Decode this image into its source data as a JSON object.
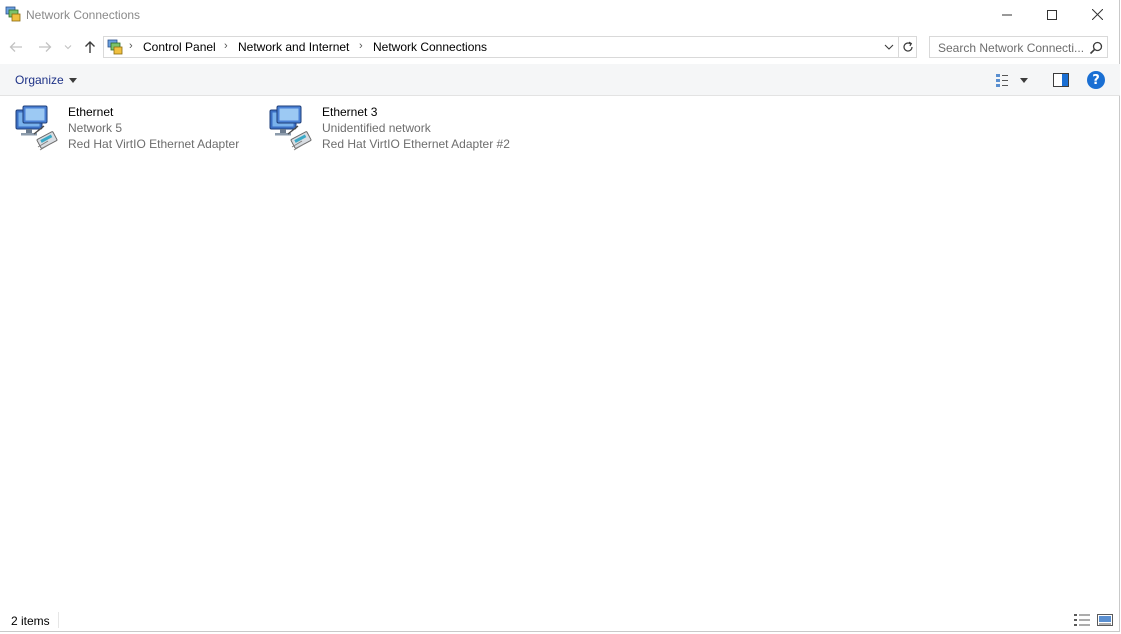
{
  "window": {
    "title": "Network Connections"
  },
  "address": {
    "crumbs": [
      "Control Panel",
      "Network and Internet",
      "Network Connections"
    ]
  },
  "search": {
    "placeholder": "Search Network Connecti..."
  },
  "toolbar": {
    "organize_label": "Organize"
  },
  "connections": [
    {
      "name": "Ethernet",
      "status": "Network  5",
      "device": "Red Hat VirtIO Ethernet Adapter"
    },
    {
      "name": "Ethernet 3",
      "status": "Unidentified network",
      "device": "Red Hat VirtIO Ethernet Adapter #2"
    }
  ],
  "statusbar": {
    "count": "2 items"
  },
  "icons": {
    "app": "network-connections-icon",
    "back": "back-arrow-icon",
    "forward": "forward-arrow-icon",
    "recent": "chevron-down-icon",
    "up": "up-arrow-icon",
    "refresh": "refresh-icon",
    "search": "search-icon",
    "help": "help-icon"
  },
  "colors": {
    "organize_text": "#1e3287",
    "help_blue": "#1a6fd3",
    "secondary_text": "#6d6d6d"
  }
}
